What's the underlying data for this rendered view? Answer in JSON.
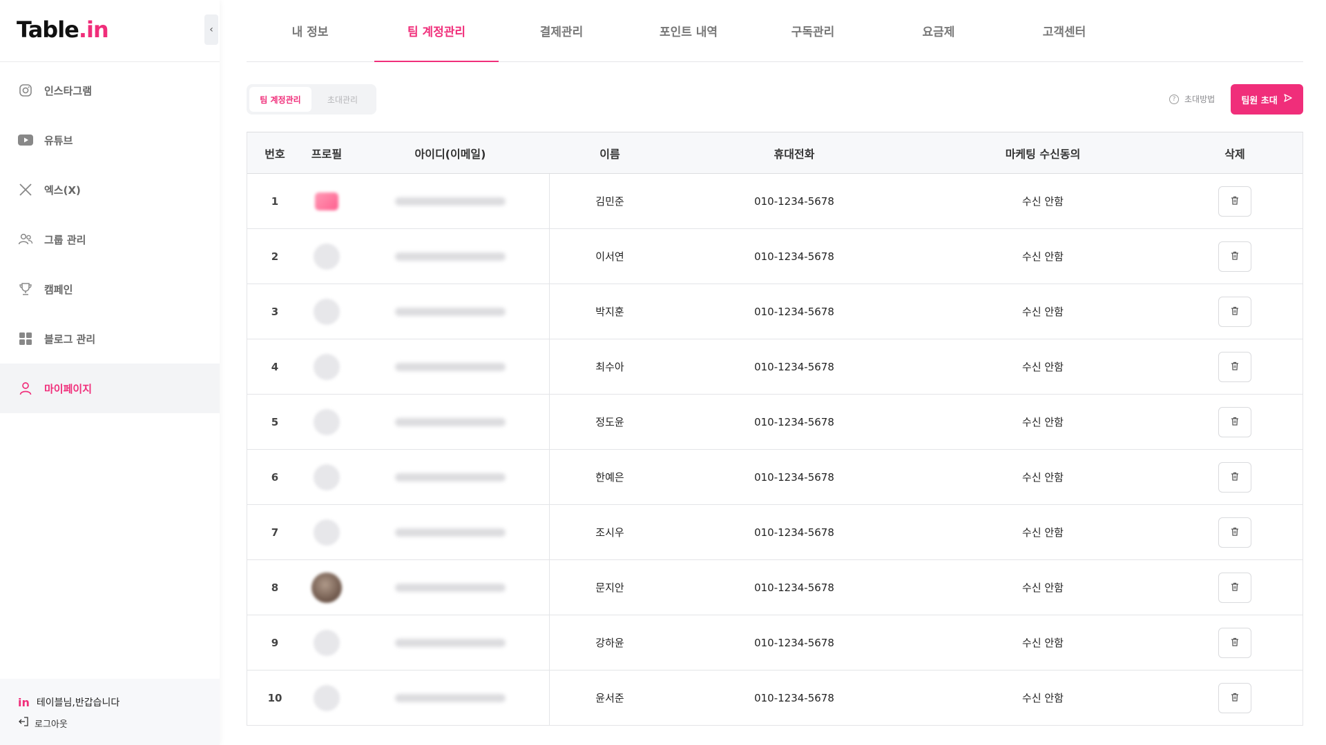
{
  "brand": {
    "logo_main": "Table",
    "logo_dot": ".",
    "logo_accent": "in",
    "accent_color": "#f02e7a"
  },
  "sidebar": {
    "items": [
      {
        "label": "인스타그램",
        "icon": "instagram-icon"
      },
      {
        "label": "유튜브",
        "icon": "youtube-icon"
      },
      {
        "label": "엑스(X)",
        "icon": "x-icon"
      },
      {
        "label": "그룹 관리",
        "icon": "group-icon"
      },
      {
        "label": "캠페인",
        "icon": "trophy-icon"
      },
      {
        "label": "블로그 관리",
        "icon": "grid-icon"
      },
      {
        "label": "마이페이지",
        "icon": "user-icon",
        "active": true
      }
    ],
    "footer": {
      "mini_logo": "in",
      "greeting": "테이블님,반갑습니다",
      "logout": "로그아웃"
    }
  },
  "tabs": [
    {
      "label": "내 정보"
    },
    {
      "label": "팀 계정관리",
      "active": true
    },
    {
      "label": "결제관리"
    },
    {
      "label": "포인트 내역"
    },
    {
      "label": "구독관리"
    },
    {
      "label": "요금제"
    },
    {
      "label": "고객센터"
    }
  ],
  "subtabs": [
    {
      "label": "팀 계정관리",
      "active": true
    },
    {
      "label": "초대관리"
    }
  ],
  "toolbar": {
    "help_label": "초대방법",
    "invite_label": "팀원 초대"
  },
  "table": {
    "headers": {
      "num": "번호",
      "profile": "프로필",
      "email": "아이디(이메일)",
      "name": "이름",
      "phone": "휴대전화",
      "marketing": "마케팅 수신동의",
      "delete": "삭제"
    },
    "rows": [
      {
        "num": "1",
        "name": "김민준",
        "phone": "010-1234-5678",
        "marketing": "수신 안함",
        "avatar": "pink"
      },
      {
        "num": "2",
        "name": "이서연",
        "phone": "010-1234-5678",
        "marketing": "수신 안함",
        "avatar": "default"
      },
      {
        "num": "3",
        "name": "박지훈",
        "phone": "010-1234-5678",
        "marketing": "수신 안함",
        "avatar": "default"
      },
      {
        "num": "4",
        "name": "최수아",
        "phone": "010-1234-5678",
        "marketing": "수신 안함",
        "avatar": "default"
      },
      {
        "num": "5",
        "name": "정도윤",
        "phone": "010-1234-5678",
        "marketing": "수신 안함",
        "avatar": "default"
      },
      {
        "num": "6",
        "name": "한예은",
        "phone": "010-1234-5678",
        "marketing": "수신 안함",
        "avatar": "default"
      },
      {
        "num": "7",
        "name": "조시우",
        "phone": "010-1234-5678",
        "marketing": "수신 안함",
        "avatar": "default"
      },
      {
        "num": "8",
        "name": "문지안",
        "phone": "010-1234-5678",
        "marketing": "수신 안함",
        "avatar": "photo"
      },
      {
        "num": "9",
        "name": "강하윤",
        "phone": "010-1234-5678",
        "marketing": "수신 안함",
        "avatar": "default"
      },
      {
        "num": "10",
        "name": "윤서준",
        "phone": "010-1234-5678",
        "marketing": "수신 안함",
        "avatar": "default"
      }
    ]
  }
}
